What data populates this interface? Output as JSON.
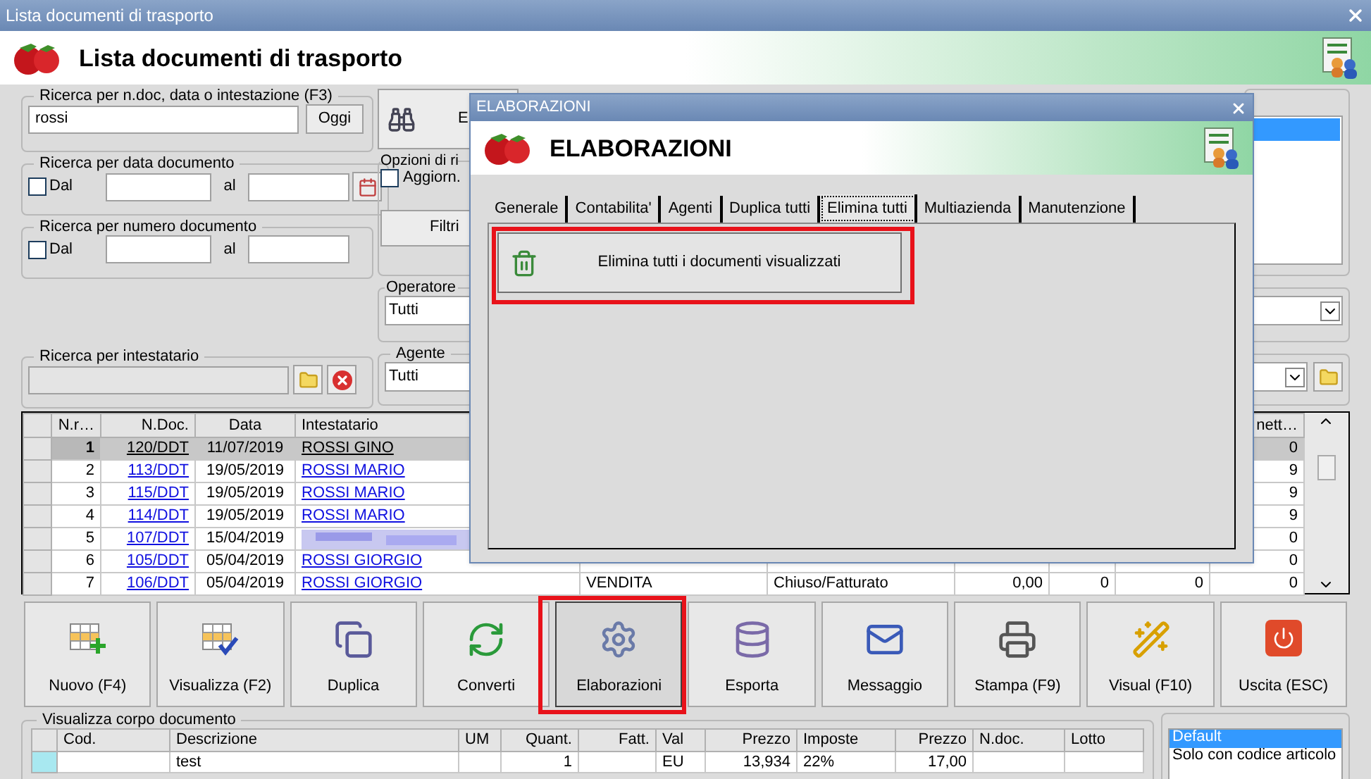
{
  "window": {
    "title": "Lista documenti di trasporto",
    "heading": "Lista documenti di trasporto"
  },
  "search": {
    "legend": "Ricerca per n.doc, data o intestazione (F3)",
    "value": "rossi",
    "today_button": "Oggi"
  },
  "date_search": {
    "legend": "Ricerca per data documento",
    "from_label": "Dal",
    "checked": false,
    "to_label": "al"
  },
  "number_search": {
    "legend": "Ricerca per numero documento",
    "from_label": "Dal",
    "checked": false,
    "to_label": "al"
  },
  "holder_search": {
    "legend": "Ricerca per intestatario"
  },
  "find_button": {
    "label": "E"
  },
  "options": {
    "legend": "Opzioni di ri",
    "refresh_label": "Aggiorn.",
    "refresh_checked": false,
    "filters_button": "Filtri"
  },
  "operator": {
    "legend": "Operatore",
    "value": "Tutti"
  },
  "agent": {
    "legend": "Agente",
    "value": "Tutti"
  },
  "table": {
    "columns": [
      "N.r…",
      "N.Doc.",
      "Data",
      "Intestatario",
      "nett…"
    ],
    "rows": [
      {
        "num": "1",
        "doc": "120/DDT",
        "date": "11/07/2019",
        "holder": "ROSSI GINO",
        "last": "0",
        "selected": true
      },
      {
        "num": "2",
        "doc": "113/DDT",
        "date": "19/05/2019",
        "holder": "ROSSI MARIO",
        "last": "9",
        "selected": false
      },
      {
        "num": "3",
        "doc": "115/DDT",
        "date": "19/05/2019",
        "holder": "ROSSI MARIO",
        "last": "9",
        "selected": false
      },
      {
        "num": "4",
        "doc": "114/DDT",
        "date": "19/05/2019",
        "holder": "ROSSI MARIO",
        "last": "9",
        "selected": false
      },
      {
        "num": "5",
        "doc": "107/DDT",
        "date": "15/04/2019",
        "blurred": true,
        "last": "0",
        "selected": false
      },
      {
        "num": "6",
        "doc": "105/DDT",
        "date": "05/04/2019",
        "holder": "ROSSI GIORGIO",
        "last": "0",
        "selected": false
      },
      {
        "num": "7",
        "doc": "106/DDT",
        "date": "05/04/2019",
        "holder": "ROSSI GIORGIO",
        "type": "VENDITA",
        "status": "Chiuso/Fatturato",
        "amount": "0,00",
        "col_8": "0",
        "col_9": "0",
        "last": "0",
        "selected": false
      }
    ]
  },
  "toolbar": [
    {
      "kind": "new",
      "label": "Nuovo (F4)",
      "highlighted": false
    },
    {
      "kind": "view",
      "label": "Visualizza (F2)",
      "highlighted": false
    },
    {
      "kind": "duplicate",
      "label": "Duplica",
      "highlighted": false
    },
    {
      "kind": "convert",
      "label": "Converti",
      "highlighted": false
    },
    {
      "kind": "process",
      "label": "Elaborazioni",
      "highlighted": true
    },
    {
      "kind": "export",
      "label": "Esporta",
      "highlighted": false
    },
    {
      "kind": "message",
      "label": "Messaggio",
      "highlighted": false
    },
    {
      "kind": "print",
      "label": "Stampa (F9)",
      "highlighted": false
    },
    {
      "kind": "visual",
      "label": "Visual (F10)",
      "highlighted": false
    },
    {
      "kind": "exit",
      "label": "Uscita (ESC)",
      "highlighted": false
    }
  ],
  "body_panel": {
    "legend": "Visualizza corpo documento",
    "columns": [
      "Cod.",
      "Descrizione",
      "UM",
      "Quant.",
      "Fatt.",
      "Val",
      "Prezzo",
      "Imposte",
      "Prezzo",
      "N.doc.",
      "Lotto"
    ],
    "rows": [
      {
        "cells": [
          "",
          "test",
          "",
          "1",
          "",
          "EU",
          "13,934",
          "22%",
          "17,00",
          "",
          ""
        ]
      }
    ],
    "views": [
      {
        "label": "Default",
        "selected": true
      },
      {
        "label": "Solo con codice articolo",
        "selected": false
      }
    ]
  },
  "dialog": {
    "title": "ELABORAZIONI",
    "heading": "ELABORAZIONI",
    "tabs": [
      {
        "label": "Generale",
        "selected": false
      },
      {
        "label": "Contabilita'",
        "selected": false
      },
      {
        "label": "Agenti",
        "selected": false
      },
      {
        "label": "Duplica tutti",
        "selected": false
      },
      {
        "label": "Elimina tutti",
        "selected": true
      },
      {
        "label": "Multiazienda",
        "selected": false
      },
      {
        "label": "Manutenzione",
        "selected": false
      }
    ],
    "action": {
      "label": "Elimina tutti i documenti visualizzati",
      "highlighted": true
    }
  }
}
